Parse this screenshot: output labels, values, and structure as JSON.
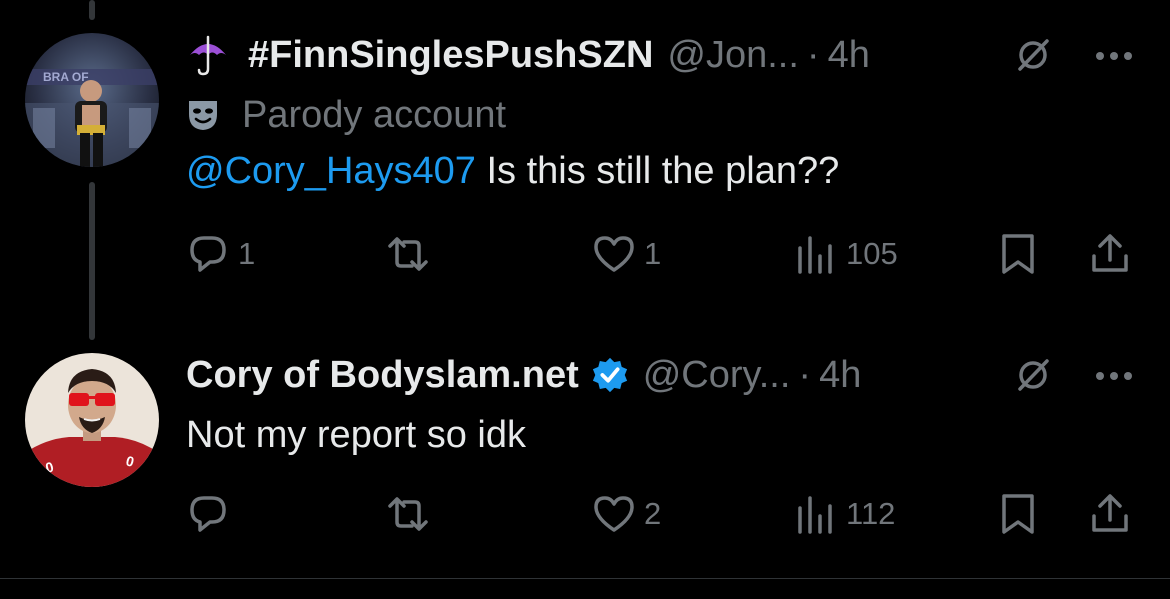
{
  "tweets": [
    {
      "display_name": "#FinnSinglesPushSZN",
      "handle": "@Jon...",
      "separator": "·",
      "time": "4h",
      "badge_label": "Parody account",
      "body": {
        "mention": "@Cory_Hays407",
        "text": " Is this still the plan??"
      },
      "actions": {
        "replies": "1",
        "reposts": "",
        "likes": "1",
        "views": "105"
      }
    },
    {
      "display_name": "Cory of Bodyslam.net",
      "handle": "@Cory...",
      "separator": "·",
      "time": "4h",
      "body": {
        "text": "Not my report so idk"
      },
      "actions": {
        "replies": "",
        "reposts": "",
        "likes": "2",
        "views": "112"
      }
    }
  ],
  "colors": {
    "background": "#000000",
    "text_primary": "#e7e9ea",
    "text_secondary": "#71767b",
    "accent": "#1d9bf0",
    "thread_line": "#333639",
    "divider": "#2f3336"
  },
  "icons": {
    "name_emoji": "umbrella-icon",
    "parody": "mask-icon",
    "verified": "verified-badge-icon",
    "header_right": [
      "grok-icon",
      "more-icon"
    ],
    "actions": [
      "reply-icon",
      "repost-icon",
      "like-icon",
      "views-icon",
      "bookmark-icon",
      "share-icon"
    ]
  }
}
